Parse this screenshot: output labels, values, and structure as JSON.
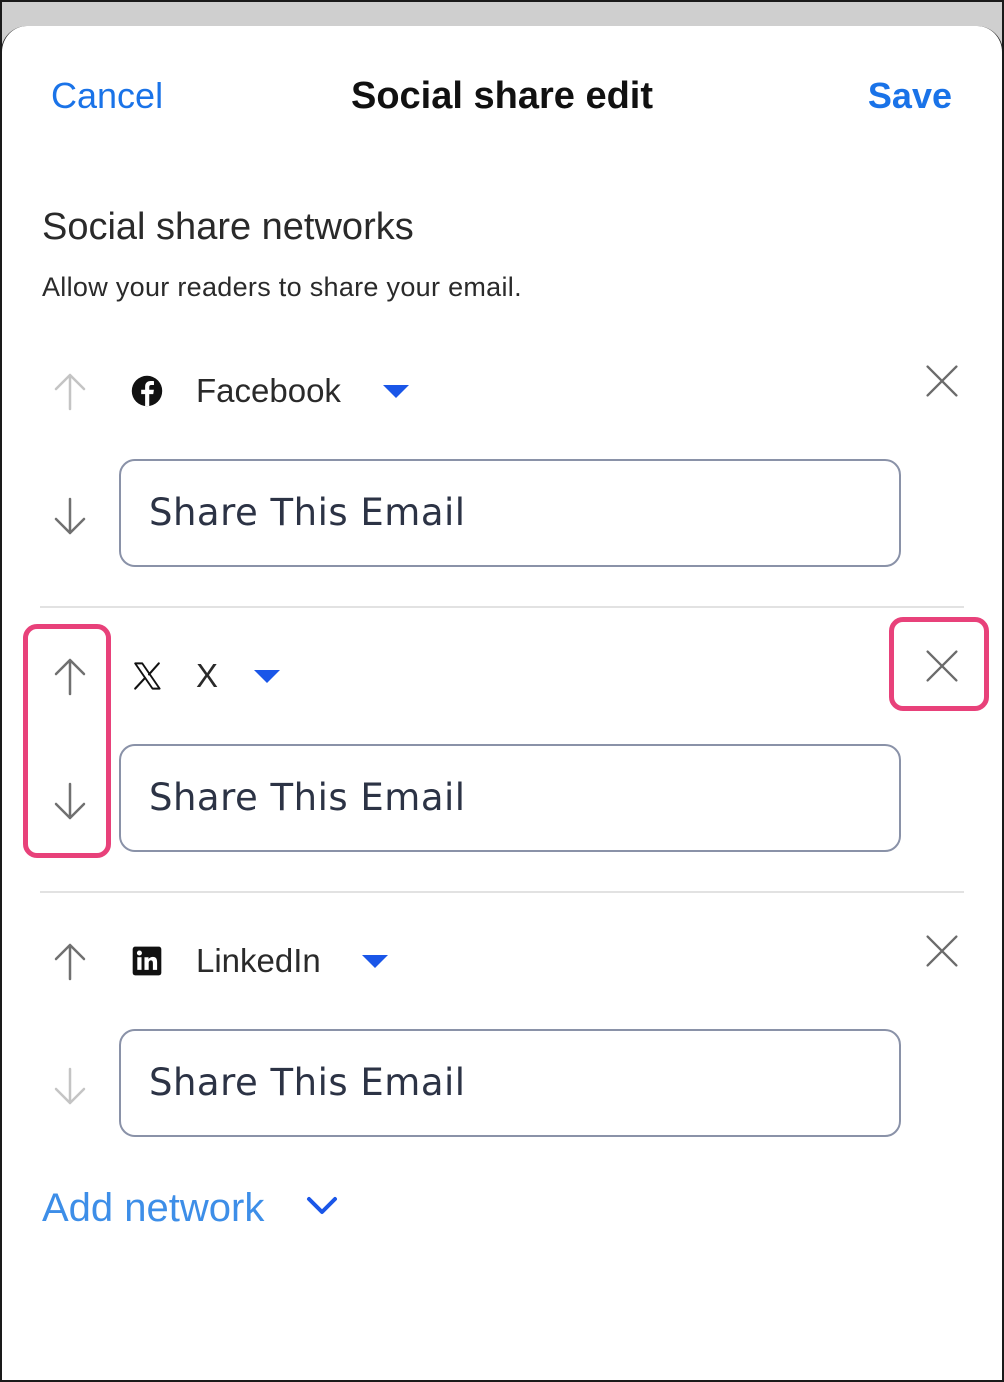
{
  "header": {
    "cancel_label": "Cancel",
    "title": "Social share edit",
    "save_label": "Save"
  },
  "section": {
    "title": "Social share networks",
    "description": "Allow your readers to share your email."
  },
  "networks": [
    {
      "name": "Facebook",
      "icon": "facebook-icon",
      "input_value": "Share This Email",
      "up_enabled": false,
      "down_enabled": true
    },
    {
      "name": "X",
      "icon": "x-logo-icon",
      "input_value": "Share This Email",
      "up_enabled": true,
      "down_enabled": true
    },
    {
      "name": "LinkedIn",
      "icon": "linkedin-icon",
      "input_value": "Share This Email",
      "up_enabled": true,
      "down_enabled": false
    }
  ],
  "add_network_label": "Add network",
  "colors": {
    "accent": "#1a73e8",
    "caret": "#1a56e8",
    "highlight": "#e8417a",
    "arrow_enabled": "#707070",
    "arrow_disabled": "#c4c4c4"
  }
}
